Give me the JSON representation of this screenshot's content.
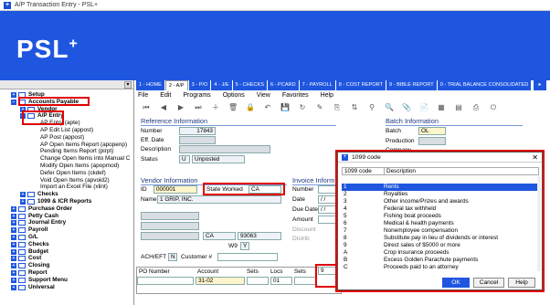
{
  "window": {
    "title": "A/P Transaction Entry - PSL+"
  },
  "banner": {
    "logo": "PSL",
    "logo_sup": "+"
  },
  "tree": {
    "items": [
      {
        "label": "Setup",
        "bold": true
      },
      {
        "label": "Accounts Payable",
        "bold": true
      },
      {
        "label": "Vendor",
        "bold": true
      },
      {
        "label": "A/P Entry",
        "bold": true
      },
      {
        "label": "AP Entry (apte)",
        "bold": false
      },
      {
        "label": "AP Edit List (appost)",
        "bold": false
      },
      {
        "label": "AP Post (appost)",
        "bold": false
      },
      {
        "label": "AP Open Items Report (apopenp)",
        "bold": false
      },
      {
        "label": "Pending Items Report (pirpt)",
        "bold": false
      },
      {
        "label": "Change Open Items into Manual C",
        "bold": false
      },
      {
        "label": "Modify Open Items (apopmod)",
        "bold": false
      },
      {
        "label": "Defer Open Items (ckdef)",
        "bold": false
      },
      {
        "label": "Void Open Items (apvoid2)",
        "bold": false
      },
      {
        "label": "Import an Excel File (xlint)",
        "bold": false
      },
      {
        "label": "Checks",
        "bold": true
      },
      {
        "label": "1099 & ICR Reports",
        "bold": true
      },
      {
        "label": "Purchase Order",
        "bold": true
      },
      {
        "label": "Petty Cash",
        "bold": true
      },
      {
        "label": "Journal Entry",
        "bold": true
      },
      {
        "label": "Payroll",
        "bold": true
      },
      {
        "label": "G/L",
        "bold": true
      },
      {
        "label": "Checks",
        "bold": true
      },
      {
        "label": "Budget",
        "bold": true
      },
      {
        "label": "Cost",
        "bold": true
      },
      {
        "label": "Closing",
        "bold": true
      },
      {
        "label": "Report",
        "bold": true
      },
      {
        "label": "Support Menu",
        "bold": true
      },
      {
        "label": "Universal",
        "bold": true
      }
    ]
  },
  "tabs": [
    "1 - HOME",
    "2 - A/P",
    "3 - P/O",
    "4 - J/E",
    "5 - CHECKS",
    "6 - PCARD",
    "7 - PAYROLL",
    "8 - COST REPORT",
    "9 - BIBLE REPORT",
    "0 - TRIAL BALANCE CONSOLIDATED"
  ],
  "menu": [
    "File",
    "Edit",
    "Programs",
    "Options",
    "View",
    "Favorites",
    "Help"
  ],
  "reference": {
    "title": "Reference Information",
    "number_label": "Number",
    "number_value": "17843",
    "eff_date_label": "Eff. Date",
    "description_label": "Description",
    "status_label": "Status",
    "status_code": "U",
    "status_text": "Unposted"
  },
  "batch": {
    "title": "Batch Information",
    "batch_label": "Batch",
    "batch_value": "OL",
    "production_label": "Production",
    "company_label": "Company"
  },
  "vendor": {
    "title": "Vendor Information",
    "id_label": "ID",
    "id_value": "000001",
    "state_worked_label": "State Worked",
    "state_worked_value": "CA",
    "name_label": "Name",
    "name_value": "1 GRIP, INC.",
    "state_value": "CA",
    "zip_value": "93063",
    "w9_label": "W9",
    "w9_value": "Y",
    "ach_label": "ACH/EFT",
    "ach_value": "N",
    "customer_label": "Customer #"
  },
  "invoice": {
    "title": "Invoice Inform",
    "number_label": "Number",
    "date_label": "Date",
    "date_value": "/ /",
    "due_date_label": "Due Date",
    "due_date_value": "/ /",
    "amount_label": "Amount",
    "discount_label": "Discount",
    "distrib_label": "Distrib"
  },
  "lines": {
    "headers": [
      "PO Number",
      "Account",
      "Sets",
      "Locs",
      "Sets"
    ],
    "row": {
      "account": "31-02",
      "locs": "01",
      "code1099": "9"
    }
  },
  "dialog": {
    "title": "1099 code",
    "close": "✕",
    "col_code": "1099 code",
    "col_desc": "Description",
    "rows": [
      {
        "code": "",
        "desc": ""
      },
      {
        "code": "1",
        "desc": "Rents"
      },
      {
        "code": "2",
        "desc": "Royalties"
      },
      {
        "code": "3",
        "desc": "Other income/Prizes and awards"
      },
      {
        "code": "4",
        "desc": "Federal tax withheld"
      },
      {
        "code": "5",
        "desc": "Fishing boat proceeds"
      },
      {
        "code": "6",
        "desc": "Medical & health payments"
      },
      {
        "code": "7",
        "desc": "Nonemployee compensation"
      },
      {
        "code": "8",
        "desc": "Substitute pay in lieu of dividends or interest"
      },
      {
        "code": "9",
        "desc": "Direct sales of $5000 or more"
      },
      {
        "code": "A",
        "desc": "Crop insurance proceeds"
      },
      {
        "code": "B",
        "desc": "Excess Golden Parachute payments"
      },
      {
        "code": "C",
        "desc": "Proceeds paid to an attorney"
      }
    ],
    "selected_index": 1,
    "ok": "OK",
    "cancel": "Cancel",
    "help": "Help"
  },
  "colors": {
    "brand": "#1f56e0",
    "highlight": "#e00000"
  }
}
